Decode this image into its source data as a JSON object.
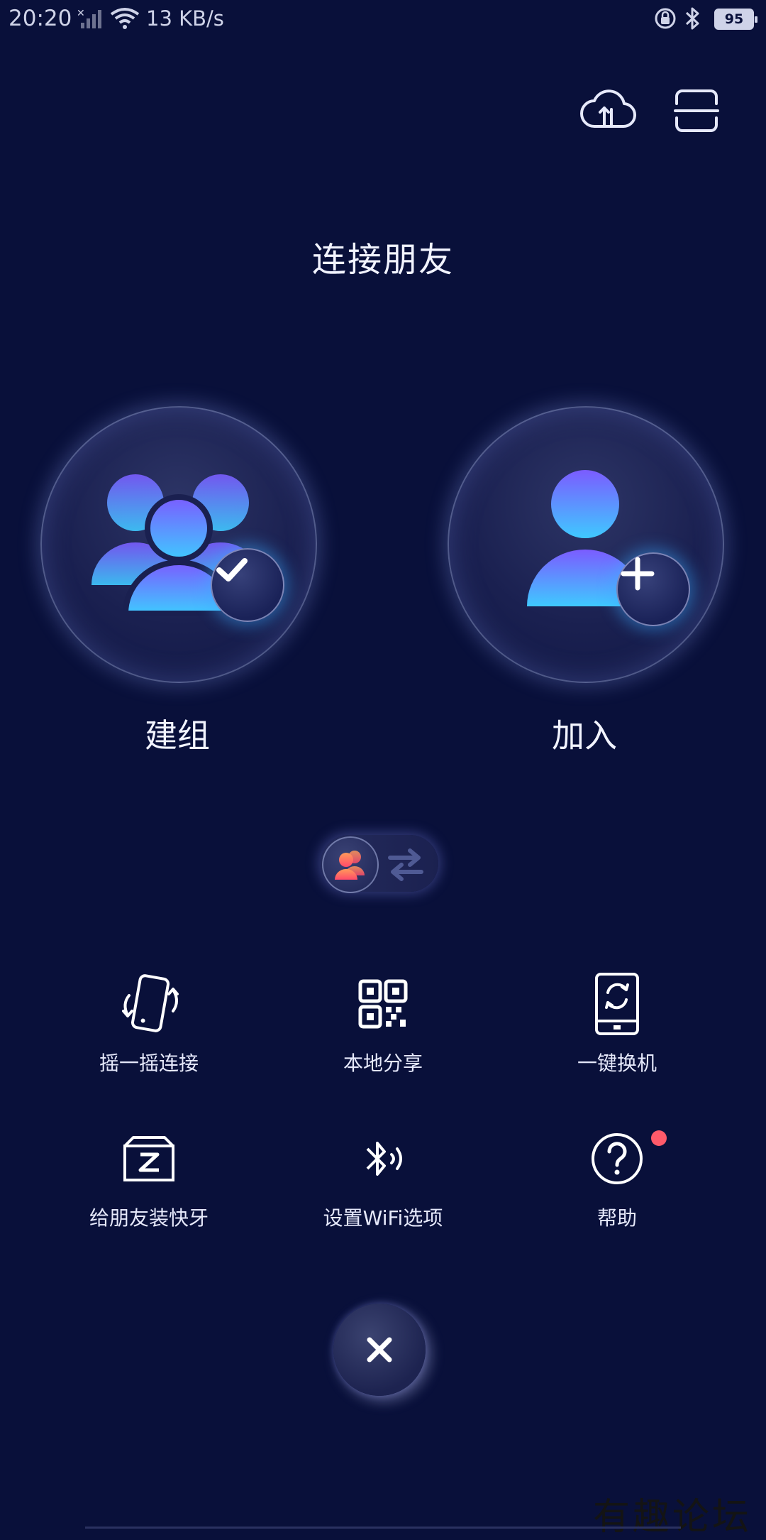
{
  "status_bar": {
    "time": "20:20",
    "speed": "13 KB/s",
    "battery": "95"
  },
  "header": {
    "title": "连接朋友"
  },
  "modes": {
    "create_label": "建组",
    "join_label": "加入"
  },
  "actions": [
    {
      "label": "摇一摇连接",
      "icon": "shake-phone-icon"
    },
    {
      "label": "本地分享",
      "icon": "qr-code-icon"
    },
    {
      "label": "一键换机",
      "icon": "phone-swap-icon"
    },
    {
      "label": "给朋友装快牙",
      "icon": "install-box-icon"
    },
    {
      "label": "设置WiFi选项",
      "icon": "bluetooth-wave-icon"
    },
    {
      "label": "帮助",
      "icon": "help-icon"
    }
  ],
  "help_badge": true,
  "watermark": "有趣论坛",
  "colors": {
    "background": "#09103a",
    "accent_blue": "#3fc9ff",
    "accent_purple": "#7a5cff",
    "notification_dot": "#ff5a6a"
  }
}
